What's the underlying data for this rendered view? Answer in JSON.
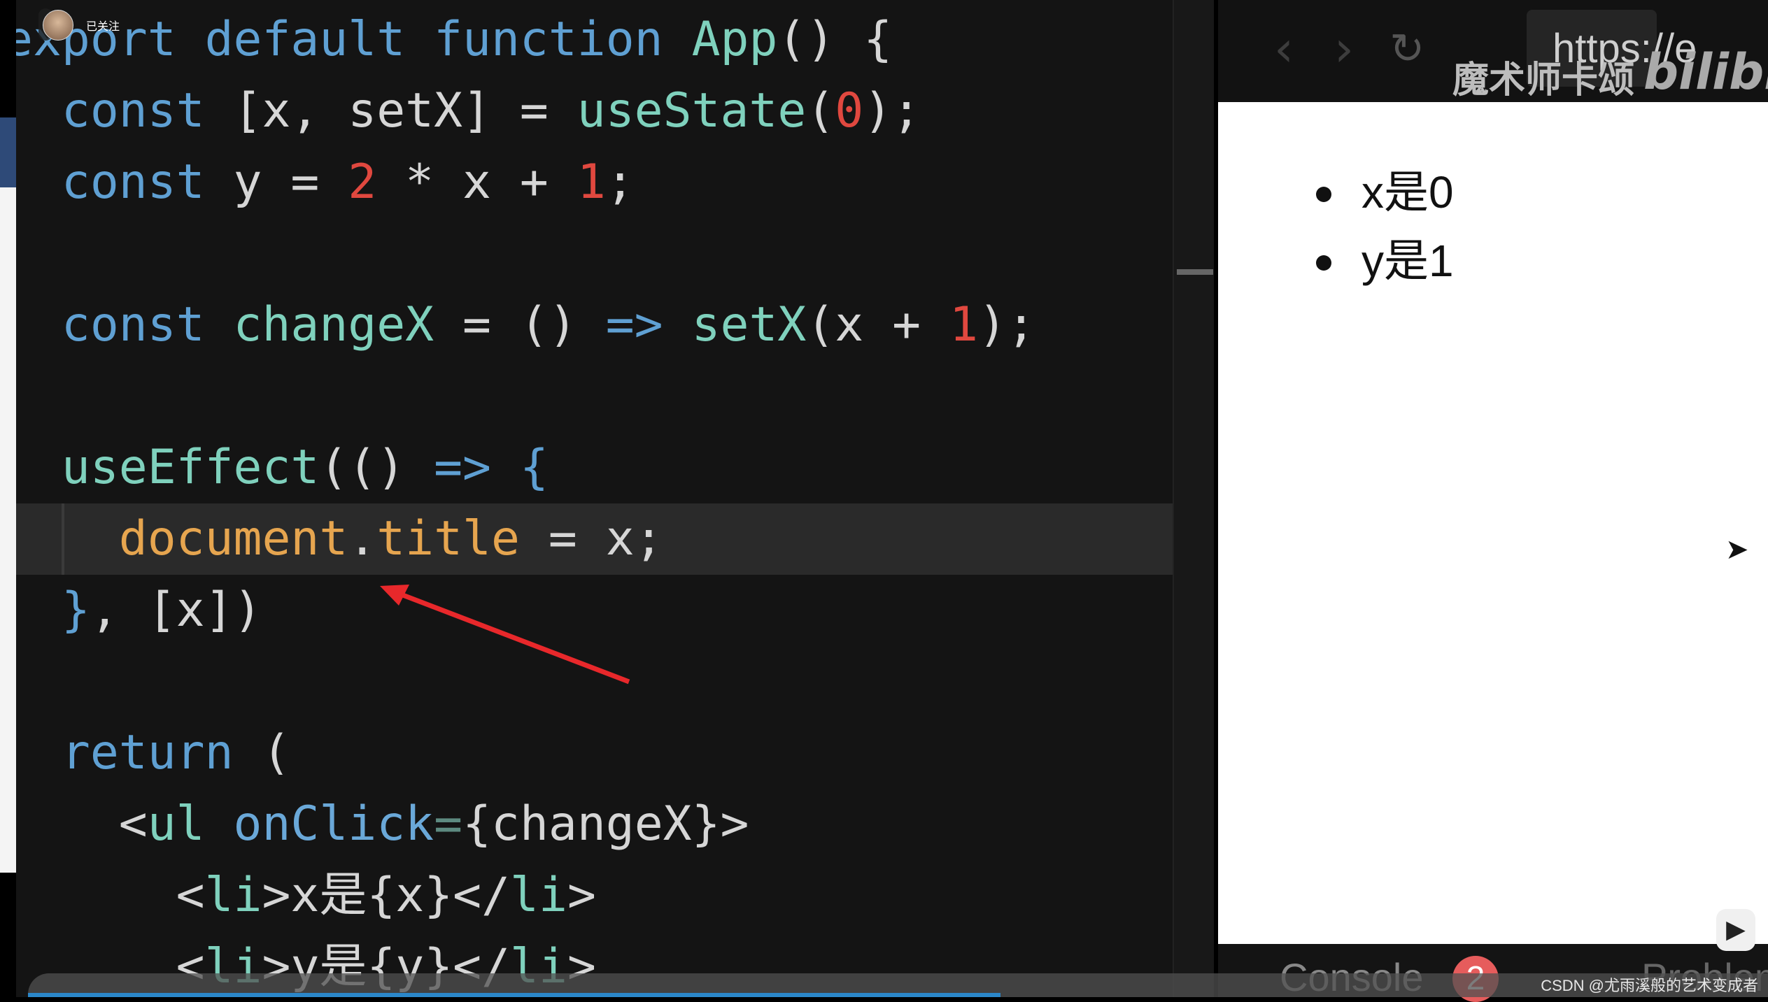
{
  "uploader": {
    "follow_label": "已关注"
  },
  "editor": {
    "lines": [
      [
        [
          "export ",
          "kw"
        ],
        [
          "default ",
          "kw"
        ],
        [
          "function ",
          "kw"
        ],
        [
          "App",
          "fn"
        ],
        [
          "() {",
          "pl"
        ]
      ],
      [
        [
          "  const ",
          "kw"
        ],
        [
          "[x, setX] = ",
          "pl"
        ],
        [
          "useState",
          "fn"
        ],
        [
          "(",
          "pl"
        ],
        [
          "0",
          "num"
        ],
        [
          ");",
          "pl"
        ]
      ],
      [
        [
          "  const ",
          "kw"
        ],
        [
          "y = ",
          "pl"
        ],
        [
          "2",
          "num"
        ],
        [
          " * x + ",
          "pl"
        ],
        [
          "1",
          "num"
        ],
        [
          ";",
          "pl"
        ]
      ],
      [],
      [
        [
          "  const ",
          "kw"
        ],
        [
          "changeX",
          "fn"
        ],
        [
          " = () ",
          "pl"
        ],
        [
          "=>",
          "kw"
        ],
        [
          " ",
          "pl"
        ],
        [
          "setX",
          "fn"
        ],
        [
          "(x + ",
          "pl"
        ],
        [
          "1",
          "num"
        ],
        [
          ");",
          "pl"
        ]
      ],
      [],
      [
        [
          "  useEffect",
          "fn"
        ],
        [
          "(() ",
          "pl"
        ],
        [
          "=>",
          "kw"
        ],
        [
          " ",
          "pl"
        ],
        [
          "{",
          "kw"
        ]
      ],
      [
        [
          "    document",
          "prop"
        ],
        [
          ".",
          "pl"
        ],
        [
          "title",
          "prop"
        ],
        [
          " = x;",
          "pl"
        ]
      ],
      [
        [
          "  }",
          "kw"
        ],
        [
          ", [x])",
          "pl"
        ]
      ],
      [],
      [
        [
          "  return",
          "kw"
        ],
        [
          " (",
          "pl"
        ]
      ],
      [
        [
          "    <",
          "pl"
        ],
        [
          "ul",
          "tag"
        ],
        [
          " ",
          "pl"
        ],
        [
          "onClick",
          "attr"
        ],
        [
          "=",
          "dim"
        ],
        [
          "{changeX}>",
          "pl"
        ]
      ],
      [
        [
          "      <",
          "pl"
        ],
        [
          "li",
          "tag"
        ],
        [
          ">x是{x}</",
          "pl"
        ],
        [
          "li",
          "tag"
        ],
        [
          ">",
          "pl"
        ]
      ],
      [
        [
          "      <",
          "pl"
        ],
        [
          "li",
          "tag"
        ],
        [
          ">y是{y}</",
          "pl"
        ],
        [
          "li",
          "tag"
        ],
        [
          ">",
          "pl"
        ]
      ]
    ]
  },
  "browser": {
    "back_icon": "chevron-left-icon",
    "forward_icon": "chevron-right-icon",
    "reload_icon": "reload-icon",
    "url": "https://e",
    "preview_items": [
      "x是0",
      "y是1"
    ],
    "console_tab": "Console",
    "console_badge": "2",
    "problems_tab": "Problem"
  },
  "watermarks": {
    "channel": "魔术师卡颂",
    "site_logo": "bilibili",
    "csdn": "CSDN @尤雨溪般的艺术变成者"
  },
  "colors": {
    "keyword": "#5fa0d3",
    "function": "#7fd1bd",
    "number": "#e0483f",
    "property": "#e6a54f",
    "arrow": "#e8282b",
    "badge": "#e65c5c"
  }
}
